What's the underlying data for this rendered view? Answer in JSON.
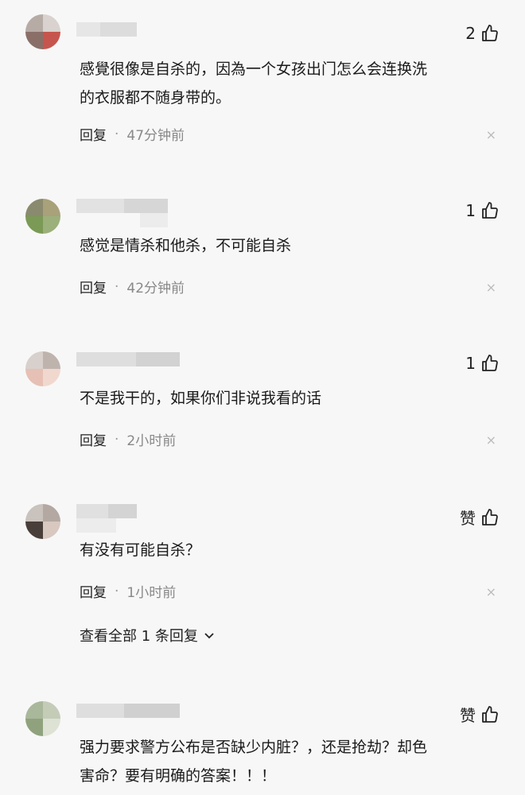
{
  "comments": [
    {
      "likes": "2",
      "text": "感覺很像是自杀的，因為一个女孩出门怎么会连换洗\n的衣服都不随身带的。",
      "reply_label": "回复",
      "time": "47分钟前"
    },
    {
      "likes": "1",
      "text": "感觉是情杀和他杀，不可能自杀",
      "reply_label": "回复",
      "time": "42分钟前"
    },
    {
      "likes": "1",
      "text": "不是我干的，如果你们非说我看的话",
      "reply_label": "回复",
      "time": "2小时前"
    },
    {
      "likes": "赞",
      "text": "有没有可能自杀？",
      "reply_label": "回复",
      "time": "1小时前"
    },
    {
      "likes": "赞",
      "text": "强力要求警方公布是否缺少内脏？，还是抢劫？却色\n害命？要有明确的答案！！！"
    }
  ],
  "view_all_replies": "查看全部 1 条回复",
  "dot": "·",
  "close_symbol": "×",
  "icons": {
    "like": "thumbs-up-icon",
    "close": "close-icon",
    "expand": "chevron-down-icon"
  }
}
